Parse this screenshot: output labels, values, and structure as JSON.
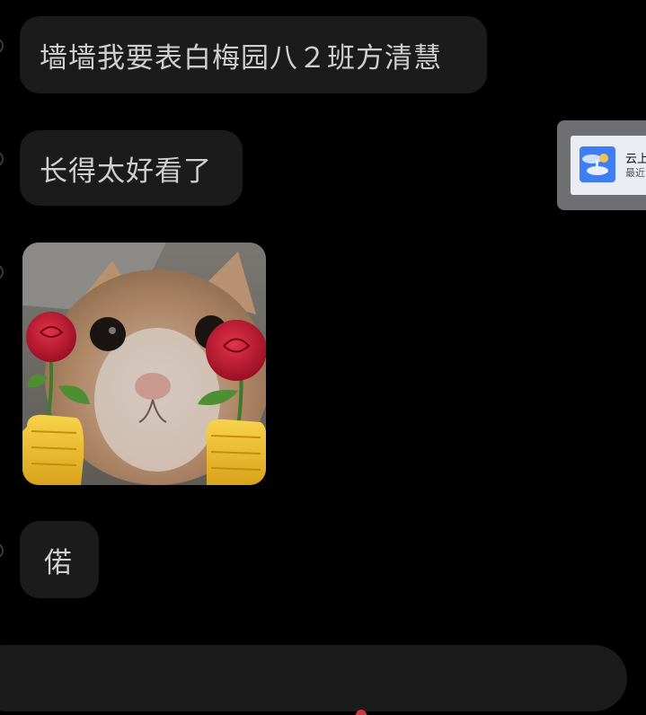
{
  "chat": {
    "messages": [
      {
        "text": "墙墙我要表白梅园八２班方清慧"
      },
      {
        "text": "长得太好看了"
      },
      {
        "sticker": "cat-holding-roses"
      },
      {
        "text": "偌"
      }
    ]
  },
  "floating_card": {
    "title": "云上",
    "subtitle": "最近"
  },
  "colors": {
    "background": "#000000",
    "bubble": "#1b1b1c",
    "bubble_text": "#cfcfcf",
    "card_frame": "#6f6f71",
    "card_icon": "#3f7df3"
  }
}
